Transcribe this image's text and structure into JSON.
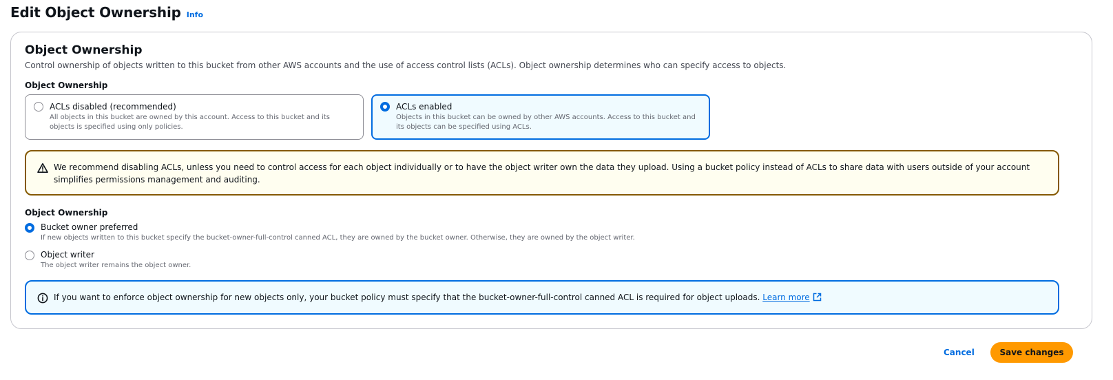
{
  "header": {
    "title": "Edit Object Ownership",
    "info_link": "Info"
  },
  "panel": {
    "title": "Object Ownership",
    "description": "Control ownership of objects written to this bucket from other AWS accounts and the use of access control lists (ACLs). Object ownership determines who can specify access to objects.",
    "acl_field_label": "Object Ownership",
    "acl_options": [
      {
        "label": "ACLs disabled (recommended)",
        "description": "All objects in this bucket are owned by this account. Access to this bucket and its objects is specified using only policies.",
        "selected": false
      },
      {
        "label": "ACLs enabled",
        "description": "Objects in this bucket can be owned by other AWS accounts. Access to this bucket and its objects can be specified using ACLs.",
        "selected": true
      }
    ],
    "warning": {
      "icon": "warning-triangle-icon",
      "text": "We recommend disabling ACLs, unless you need to control access for each object individually or to have the object writer own the data they upload. Using a bucket policy instead of ACLs to share data with users outside of your account simplifies permissions management and auditing."
    },
    "ownership_field_label": "Object Ownership",
    "ownership_options": [
      {
        "label": "Bucket owner preferred",
        "description": "If new objects written to this bucket specify the bucket-owner-full-control canned ACL, they are owned by the bucket owner. Otherwise, they are owned by the object writer.",
        "selected": true
      },
      {
        "label": "Object writer",
        "description": "The object writer remains the object owner.",
        "selected": false
      }
    ],
    "info_alert": {
      "icon": "info-circle-icon",
      "text": "If you want to enforce object ownership for new objects only, your bucket policy must specify that the bucket-owner-full-control canned ACL is required for object uploads.",
      "link": "Learn more"
    }
  },
  "footer": {
    "cancel": "Cancel",
    "save": "Save changes"
  },
  "colors": {
    "accent": "#006ce0",
    "primary_button": "#ff9900",
    "warning_border": "#855900",
    "warning_bg": "#fffef0",
    "info_bg": "#f0fbff"
  }
}
